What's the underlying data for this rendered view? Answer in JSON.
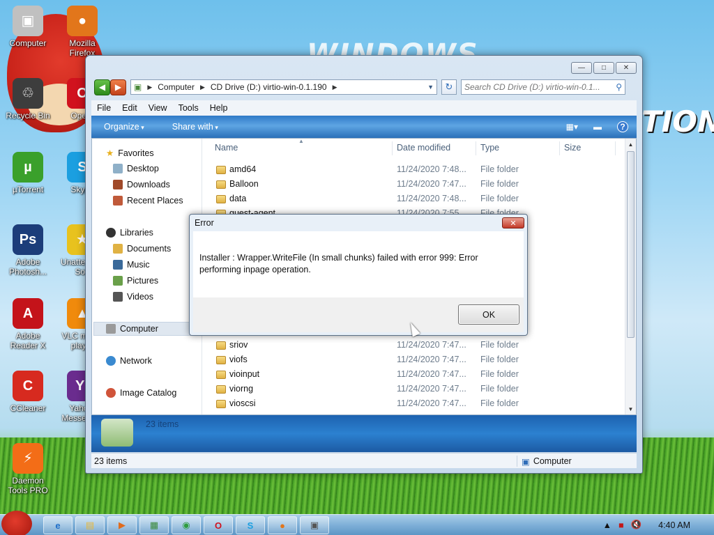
{
  "desktop": {
    "icons": [
      {
        "label": "Computer",
        "glyph": "▣",
        "color": "#c0c0c0",
        "icon": "computer-icon"
      },
      {
        "label": "Mozilla Firefox",
        "glyph": "●",
        "color": "#e2761b",
        "icon": "firefox-icon"
      },
      {
        "label": "Recycle Bin",
        "glyph": "♲",
        "color": "#3d3d3d",
        "icon": "recycle-bin-icon"
      },
      {
        "label": "Opera",
        "glyph": "O",
        "color": "#d1121e",
        "icon": "opera-icon"
      },
      {
        "label": "µTorrent",
        "glyph": "µ",
        "color": "#3aa02b",
        "icon": "utorrent-icon"
      },
      {
        "label": "Skype",
        "glyph": "S",
        "color": "#1b9fe0",
        "icon": "skype-icon"
      },
      {
        "label": "Adobe Photosh...",
        "glyph": "Ps",
        "color": "#1c3d7a",
        "icon": "photoshop-icon"
      },
      {
        "label": "Unattended Soft",
        "glyph": "★",
        "color": "#e8c21e",
        "icon": "star-icon"
      },
      {
        "label": "Adobe Reader X",
        "glyph": "A",
        "color": "#c4131a",
        "icon": "adobe-reader-icon"
      },
      {
        "label": "VLC media player",
        "glyph": "▲",
        "color": "#f08a0c",
        "icon": "vlc-icon"
      },
      {
        "label": "CCleaner",
        "glyph": "C",
        "color": "#d72a1f",
        "icon": "ccleaner-icon"
      },
      {
        "label": "Yahoo! Messenger",
        "glyph": "Y!",
        "color": "#6a2c8e",
        "icon": "yahoo-messenger-icon"
      },
      {
        "label": "Daemon Tools PRO",
        "glyph": "⚡",
        "color": "#f36d17",
        "icon": "daemon-tools-icon"
      }
    ],
    "deco_text_top": "WINDOWS",
    "deco_text_right": "TION"
  },
  "explorer": {
    "address": {
      "segments": [
        "Computer",
        "CD Drive (D:) virtio-win-0.1.190"
      ]
    },
    "search_placeholder": "Search CD Drive (D:) virtio-win-0.1...",
    "menu": [
      "File",
      "Edit",
      "View",
      "Tools",
      "Help"
    ],
    "toolbar": {
      "organize": "Organize",
      "share_with": "Share with"
    },
    "nav": {
      "favorites": "Favorites",
      "desktop": "Desktop",
      "downloads": "Downloads",
      "recent_places": "Recent Places",
      "libraries": "Libraries",
      "documents": "Documents",
      "music": "Music",
      "pictures": "Pictures",
      "videos": "Videos",
      "computer": "Computer",
      "network": "Network",
      "image_catalog": "Image Catalog"
    },
    "columns": {
      "name": "Name",
      "date_modified": "Date modified",
      "type": "Type",
      "size": "Size"
    },
    "files_top": [
      {
        "name": "amd64",
        "date": "11/24/2020 7:48...",
        "type": "File folder"
      },
      {
        "name": "Balloon",
        "date": "11/24/2020 7:47...",
        "type": "File folder"
      },
      {
        "name": "data",
        "date": "11/24/2020 7:48...",
        "type": "File folder"
      },
      {
        "name": "guest-agent",
        "date": "11/24/2020 7:55...",
        "type": "File folder"
      }
    ],
    "files_bottom": [
      {
        "name": "sriov",
        "date": "11/24/2020 7:47...",
        "type": "File folder"
      },
      {
        "name": "viofs",
        "date": "11/24/2020 7:47...",
        "type": "File folder"
      },
      {
        "name": "vioinput",
        "date": "11/24/2020 7:47...",
        "type": "File folder"
      },
      {
        "name": "viorng",
        "date": "11/24/2020 7:47...",
        "type": "File folder"
      },
      {
        "name": "vioscsi",
        "date": "11/24/2020 7:47...",
        "type": "File folder"
      }
    ],
    "details_count": "23 items",
    "status_count": "23 items",
    "status_location": "Computer"
  },
  "dialog": {
    "title": "Error",
    "close_glyph": "✕",
    "message": "Installer : Wrapper.WriteFile (In small chunks)  failed with error 999: Error performing inpage operation.",
    "ok_label": "OK"
  },
  "taskbar": {
    "clock": "4:40 AM",
    "pinned": [
      {
        "glyph": "e",
        "color": "#1f6fc9",
        "icon": "internet-explorer-icon"
      },
      {
        "glyph": "▤",
        "color": "#e8b83a",
        "icon": "folder-icon"
      },
      {
        "glyph": "▶",
        "color": "#e06b1c",
        "icon": "media-player-icon"
      },
      {
        "glyph": "▦",
        "color": "#3c8a3c",
        "icon": "explorer-window-icon"
      },
      {
        "glyph": "◉",
        "color": "#2f9d3f",
        "icon": "chrome-icon"
      },
      {
        "glyph": "O",
        "color": "#d1121e",
        "icon": "opera-icon"
      },
      {
        "glyph": "S",
        "color": "#1b9fe0",
        "icon": "skype-icon"
      },
      {
        "glyph": "●",
        "color": "#e2761b",
        "icon": "firefox-icon"
      },
      {
        "glyph": "▣",
        "color": "#555555",
        "icon": "installer-window-icon"
      }
    ]
  },
  "colors": {
    "command_bar": "#2f7ac7",
    "error_close": "#c33a28",
    "folder": "#e0b244"
  }
}
